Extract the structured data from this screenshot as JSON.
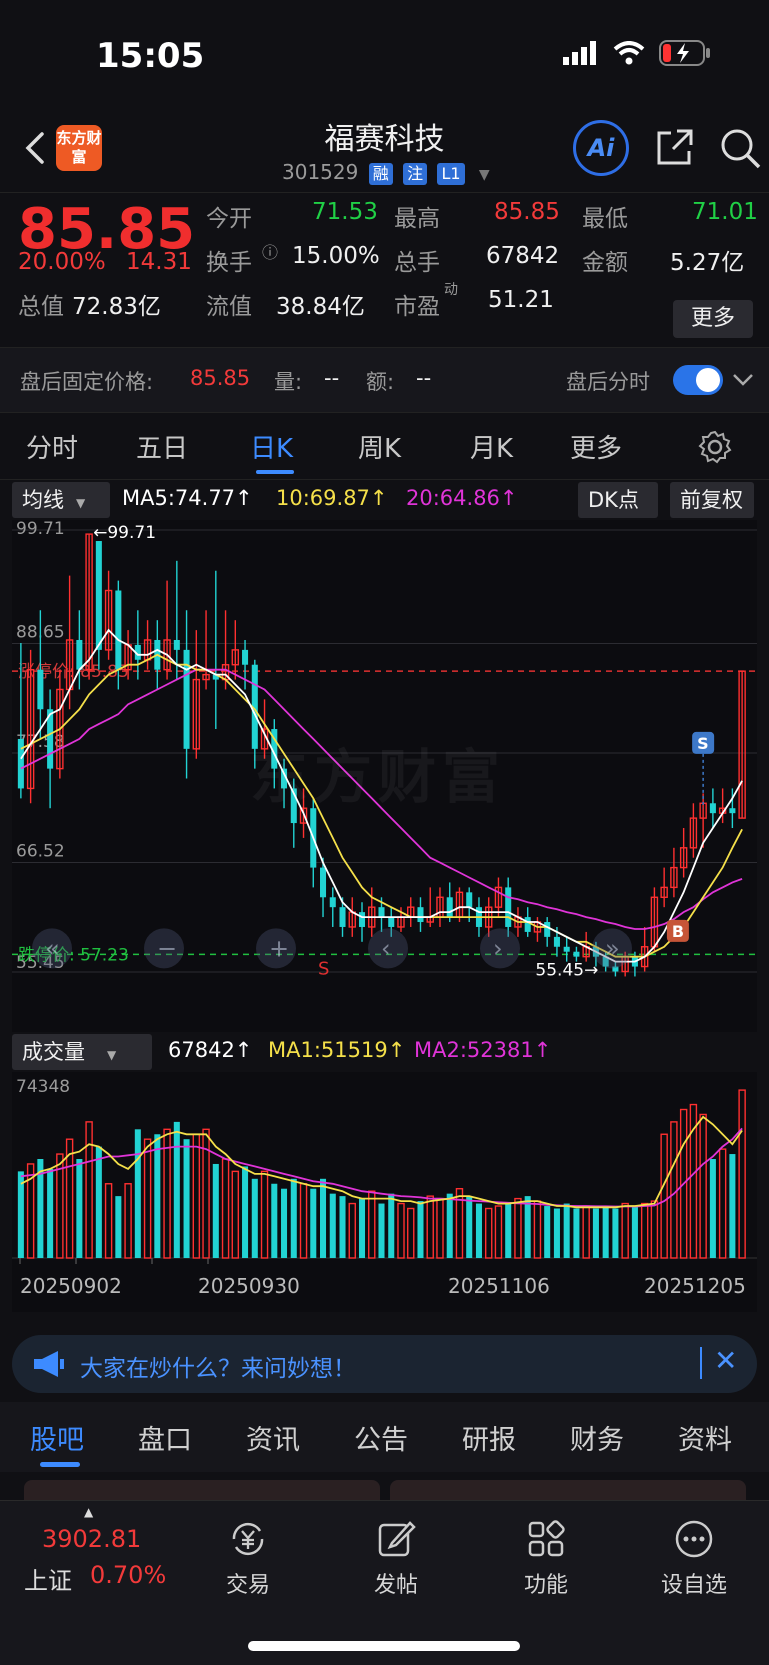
{
  "status_bar": {
    "time": "15:05"
  },
  "header": {
    "logo_text": "东方财富",
    "stock_name": "福赛科技",
    "stock_code": "301529",
    "tags": [
      "融",
      "注",
      "L1"
    ],
    "ai_label": "Ai",
    "icons": [
      "back-icon",
      "share-icon",
      "search-icon"
    ]
  },
  "quote": {
    "price": "85.85",
    "change_pct": "20.00%",
    "change": "14.31",
    "open_label": "今开",
    "open": "71.53",
    "high_label": "最高",
    "high": "85.85",
    "low_label": "最低",
    "low": "71.01",
    "turnover_label": "换手",
    "turnover": "15.00%",
    "volume_label": "总手",
    "volume": "67842",
    "amount_label": "金额",
    "amount": "5.27亿",
    "mktcap_label": "总值",
    "mktcap": "72.83亿",
    "float_label": "流值",
    "float": "38.84亿",
    "pe_label": "市盈",
    "pe_sup": "动",
    "pe": "51.21",
    "more": "更多"
  },
  "after_hours": {
    "price_label": "盘后固定价格:",
    "price": "85.85",
    "vol_label": "量:",
    "vol": "--",
    "amt_label": "额:",
    "amt": "--",
    "intraday_label": "盘后分时",
    "toggle_on": true
  },
  "period_tabs": {
    "items": [
      "分时",
      "五日",
      "日K",
      "周K",
      "月K",
      "更多"
    ],
    "active": "日K"
  },
  "ma_bar": {
    "type_label": "均线",
    "ma5": "MA5:74.77↑",
    "ma10": "10:69.87↑",
    "ma20": "20:64.86↑",
    "dk": "DK点",
    "adjust": "前复权",
    "colors": {
      "ma5": "#ffffff",
      "ma10": "#f5e04a",
      "ma20": "#e034d8"
    }
  },
  "chart_labels": {
    "y_ticks": [
      "99.71",
      "88.65",
      "77.58",
      "66.52",
      "55.45"
    ],
    "max_marker": "←99.71",
    "min_marker": "55.45→",
    "limit_up": "涨停价: 85.85",
    "limit_down": "跌停价: 57.23",
    "watermark": "东方财富",
    "signal_s": "S",
    "signal_b": "B",
    "marker_s": "S"
  },
  "volume_bar": {
    "type_label": "成交量",
    "value": "67842↑",
    "ma1": "MA1:51519↑",
    "ma2": "MA2:52381↑",
    "max_label": "74348"
  },
  "chart_data": {
    "type": "candlestick",
    "ylim": [
      55.45,
      99.71
    ],
    "x_tick_labels": [
      "20250902",
      "20250930",
      "20251106",
      "20251205"
    ],
    "candles": [
      [
        79.0,
        74.0,
        88.7,
        73.0
      ],
      [
        74.0,
        86.0,
        88.0,
        72.5
      ],
      [
        86.0,
        82.0,
        92.0,
        79.0
      ],
      [
        82.0,
        76.0,
        84.0,
        72.0
      ],
      [
        76.0,
        84.0,
        86.0,
        75.0
      ],
      [
        84.0,
        89.0,
        95.5,
        82.0
      ],
      [
        89.0,
        86.0,
        92.0,
        84.0
      ],
      [
        86.0,
        99.7,
        99.7,
        85.0
      ],
      [
        99.0,
        88.0,
        99.0,
        86.0
      ],
      [
        88.0,
        94.0,
        96.0,
        87.0
      ],
      [
        94.0,
        86.0,
        95.0,
        84.0
      ],
      [
        86.0,
        88.5,
        90.0,
        85.0
      ],
      [
        88.5,
        87.0,
        92.0,
        85.0
      ],
      [
        87.0,
        89.0,
        91.0,
        86.0
      ],
      [
        89.0,
        86.0,
        91.0,
        84.0
      ],
      [
        86.0,
        89.0,
        95.0,
        85.0
      ],
      [
        89.0,
        88.0,
        97.0,
        85.0
      ],
      [
        88.0,
        78.0,
        92.0,
        75.0
      ],
      [
        78.0,
        85.0,
        90.0,
        77.0
      ],
      [
        85.0,
        85.5,
        92.0,
        84.0
      ],
      [
        85.5,
        85.0,
        96.0,
        80.0
      ],
      [
        85.0,
        86.5,
        92.0,
        84.0
      ],
      [
        86.5,
        88.0,
        91.0,
        85.0
      ],
      [
        88.0,
        86.5,
        89.0,
        84.0
      ],
      [
        86.5,
        78.0,
        87.0,
        76.0
      ],
      [
        78.0,
        80.0,
        83.0,
        77.0
      ],
      [
        80.0,
        76.0,
        81.0,
        74.0
      ],
      [
        76.0,
        74.0,
        77.0,
        72.0
      ],
      [
        74.0,
        70.5,
        75.0,
        68.0
      ],
      [
        70.5,
        72.0,
        74.0,
        69.0
      ],
      [
        72.0,
        66.0,
        73.0,
        64.0
      ],
      [
        66.0,
        63.0,
        67.0,
        61.0
      ],
      [
        63.0,
        62.0,
        64.0,
        60.0
      ],
      [
        62.0,
        60.0,
        63.0,
        59.0
      ],
      [
        60.0,
        61.5,
        63.0,
        59.0
      ],
      [
        61.5,
        60.0,
        62.5,
        58.5
      ],
      [
        60.0,
        62.0,
        64.0,
        59.0
      ],
      [
        62.0,
        61.0,
        63.0,
        59.5
      ],
      [
        61.0,
        60.0,
        62.0,
        59.0
      ],
      [
        60.0,
        61.0,
        62.0,
        59.5
      ],
      [
        61.0,
        62.0,
        63.0,
        60.0
      ],
      [
        62.0,
        60.5,
        63.0,
        59.5
      ],
      [
        60.5,
        61.0,
        64.0,
        60.0
      ],
      [
        61.0,
        63.0,
        64.0,
        60.0
      ],
      [
        63.0,
        61.0,
        64.5,
        60.5
      ],
      [
        61.0,
        63.5,
        64.0,
        60.5
      ],
      [
        63.5,
        62.0,
        64.0,
        60.5
      ],
      [
        62.0,
        60.0,
        63.0,
        59.0
      ],
      [
        60.0,
        62.0,
        63.0,
        59.0
      ],
      [
        62.0,
        64.0,
        65.0,
        61.0
      ],
      [
        64.0,
        60.0,
        65.0,
        59.0
      ],
      [
        60.0,
        61.0,
        62.0,
        59.0
      ],
      [
        61.0,
        59.5,
        62.0,
        59.0
      ],
      [
        59.5,
        60.5,
        61.0,
        58.5
      ],
      [
        60.5,
        59.0,
        61.0,
        58.0
      ],
      [
        59.0,
        58.0,
        60.0,
        57.0
      ],
      [
        58.0,
        57.5,
        59.0,
        56.5
      ],
      [
        57.5,
        57.0,
        58.0,
        56.5
      ],
      [
        57.0,
        58.0,
        59.5,
        56.5
      ],
      [
        58.0,
        57.0,
        58.5,
        56.0
      ],
      [
        57.0,
        56.0,
        57.5,
        55.5
      ],
      [
        56.0,
        55.5,
        56.5,
        55.0
      ],
      [
        55.5,
        57.0,
        57.5,
        55.0
      ],
      [
        57.0,
        56.0,
        57.5,
        55.0
      ],
      [
        56.0,
        58.0,
        60.0,
        55.5
      ],
      [
        58.0,
        63.0,
        64.0,
        57.5
      ],
      [
        63.0,
        64.0,
        66.0,
        62.0
      ],
      [
        64.0,
        66.0,
        68.0,
        63.0
      ],
      [
        66.0,
        68.0,
        70.0,
        65.0
      ],
      [
        68.0,
        71.0,
        72.5,
        67.0
      ],
      [
        71.0,
        72.5,
        73.5,
        68.0
      ],
      [
        72.5,
        71.5,
        74.0,
        70.0
      ],
      [
        71.5,
        72.0,
        74.0,
        70.5
      ],
      [
        72.0,
        71.5,
        74.0,
        70.0
      ],
      [
        71.0,
        85.85,
        85.85,
        71.0
      ]
    ],
    "ma5": [
      77.0,
      78.5,
      80.0,
      81.5,
      82.0,
      84.0,
      86.0,
      87.0,
      88.5,
      90.0,
      89.0,
      88.5,
      87.5,
      87.5,
      88.0,
      87.5,
      86.5,
      86.0,
      86.5,
      86.0,
      85.5,
      85.5,
      84.5,
      83.5,
      81.5,
      79.5,
      77.5,
      75.5,
      73.5,
      71.5,
      69.0,
      66.5,
      64.5,
      62.5,
      61.5,
      61.0,
      61.0,
      61.0,
      61.0,
      61.0,
      61.0,
      61.0,
      61.0,
      61.5,
      61.5,
      62.0,
      62.0,
      61.5,
      61.5,
      61.5,
      61.5,
      61.0,
      60.5,
      60.5,
      60.0,
      59.5,
      59.0,
      58.5,
      58.0,
      57.5,
      57.0,
      56.5,
      56.5,
      56.5,
      57.0,
      58.0,
      59.5,
      61.5,
      63.5,
      66.0,
      68.5,
      70.0,
      71.5,
      73.0,
      74.77
    ],
    "ma10": [
      78.0,
      78.5,
      79.0,
      79.5,
      80.0,
      81.0,
      82.0,
      83.5,
      84.5,
      85.5,
      86.0,
      86.5,
      86.5,
      87.0,
      87.5,
      87.0,
      86.5,
      86.5,
      86.0,
      86.0,
      85.5,
      85.0,
      84.0,
      83.0,
      82.0,
      80.5,
      79.0,
      77.5,
      76.0,
      74.5,
      73.0,
      71.0,
      69.0,
      67.0,
      65.5,
      64.0,
      63.0,
      62.5,
      62.0,
      61.5,
      61.0,
      61.0,
      61.0,
      61.0,
      61.0,
      61.0,
      61.0,
      61.0,
      61.0,
      61.0,
      61.0,
      60.5,
      60.5,
      60.0,
      60.0,
      59.5,
      59.0,
      58.5,
      58.5,
      58.0,
      57.5,
      57.0,
      57.0,
      57.0,
      57.0,
      57.5,
      58.0,
      59.0,
      60.0,
      61.5,
      63.0,
      64.5,
      66.0,
      68.0,
      69.87
    ],
    "ma20": [
      76.0,
      76.5,
      77.0,
      77.5,
      78.0,
      78.5,
      79.0,
      80.0,
      80.5,
      81.0,
      81.5,
      82.5,
      83.0,
      83.5,
      84.0,
      84.5,
      85.0,
      85.5,
      86.0,
      86.0,
      86.0,
      86.0,
      85.5,
      85.0,
      84.5,
      84.0,
      83.0,
      82.0,
      81.0,
      80.0,
      79.0,
      78.0,
      77.0,
      76.0,
      75.0,
      74.0,
      73.0,
      72.0,
      71.0,
      70.0,
      69.0,
      68.0,
      67.0,
      66.5,
      66.0,
      65.5,
      65.0,
      64.5,
      64.0,
      63.5,
      63.0,
      62.8,
      62.5,
      62.3,
      62.0,
      61.8,
      61.5,
      61.3,
      61.0,
      60.8,
      60.5,
      60.3,
      60.0,
      59.8,
      59.8,
      60.0,
      60.3,
      60.8,
      61.5,
      62.0,
      62.8,
      63.5,
      64.0,
      64.5,
      64.86
    ],
    "volume": [
      35000,
      38000,
      40000,
      36000,
      42000,
      48000,
      40000,
      55000,
      45000,
      30000,
      25000,
      30000,
      52000,
      48000,
      50000,
      52000,
      55000,
      48000,
      50000,
      52000,
      38000,
      40000,
      35000,
      37000,
      32000,
      35000,
      30000,
      28000,
      32000,
      30000,
      28000,
      32000,
      26000,
      25000,
      22000,
      24000,
      27000,
      22000,
      26000,
      22000,
      20000,
      23000,
      25000,
      24000,
      26000,
      28000,
      25000,
      22000,
      20000,
      21000,
      22000,
      24000,
      25000,
      23000,
      21000,
      20000,
      22000,
      20000,
      21000,
      20000,
      21000,
      20000,
      22000,
      21000,
      22000,
      23000,
      50000,
      55000,
      60000,
      62000,
      58000,
      40000,
      44000,
      42000,
      67842
    ],
    "vol_ma1": [
      30000,
      32000,
      35000,
      36000,
      38000,
      42000,
      43000,
      46000,
      45000,
      42000,
      38000,
      36000,
      40000,
      45000,
      48000,
      50000,
      51000,
      50000,
      50000,
      50000,
      45000,
      42000,
      38000,
      36000,
      34000,
      34000,
      33000,
      32000,
      31000,
      30000,
      29000,
      29000,
      28000,
      27000,
      25000,
      24000,
      24000,
      24000,
      24000,
      23000,
      23000,
      22000,
      23000,
      23500,
      24000,
      25000,
      25000,
      24000,
      23000,
      22000,
      22000,
      22500,
      23000,
      23000,
      22000,
      21000,
      21000,
      20500,
      20500,
      20500,
      20500,
      20500,
      21000,
      21000,
      21500,
      22000,
      30000,
      38000,
      46000,
      52000,
      57000,
      54000,
      50000,
      46000,
      51519
    ],
    "vol_ma2": [
      33000,
      33500,
      34000,
      35000,
      36000,
      37000,
      38000,
      39000,
      40000,
      41000,
      41000,
      41500,
      42000,
      43000,
      44000,
      44500,
      45000,
      45000,
      45000,
      44000,
      42000,
      40000,
      39000,
      38000,
      37000,
      36000,
      35000,
      34000,
      33000,
      32000,
      31000,
      30500,
      30000,
      29000,
      28000,
      27000,
      26500,
      26000,
      25500,
      25000,
      24800,
      24500,
      24000,
      24000,
      23800,
      23500,
      23200,
      23000,
      22800,
      22500,
      22300,
      22100,
      22000,
      21800,
      21500,
      21300,
      21100,
      21000,
      21000,
      20900,
      20900,
      20800,
      20800,
      20800,
      21000,
      21200,
      23000,
      26000,
      30000,
      34000,
      38000,
      41000,
      45000,
      48000,
      52381
    ]
  },
  "banner": {
    "text": "大家在炒什么？来问妙想！"
  },
  "bottom_tabs": {
    "items": [
      "股吧",
      "盘口",
      "资讯",
      "公告",
      "研报",
      "财务",
      "资料"
    ],
    "active": "股吧"
  },
  "bottom_nav": {
    "index_value": "3902.81",
    "index_name": "上证",
    "index_change": "0.70%",
    "items": [
      "交易",
      "发帖",
      "功能",
      "设自选"
    ]
  }
}
